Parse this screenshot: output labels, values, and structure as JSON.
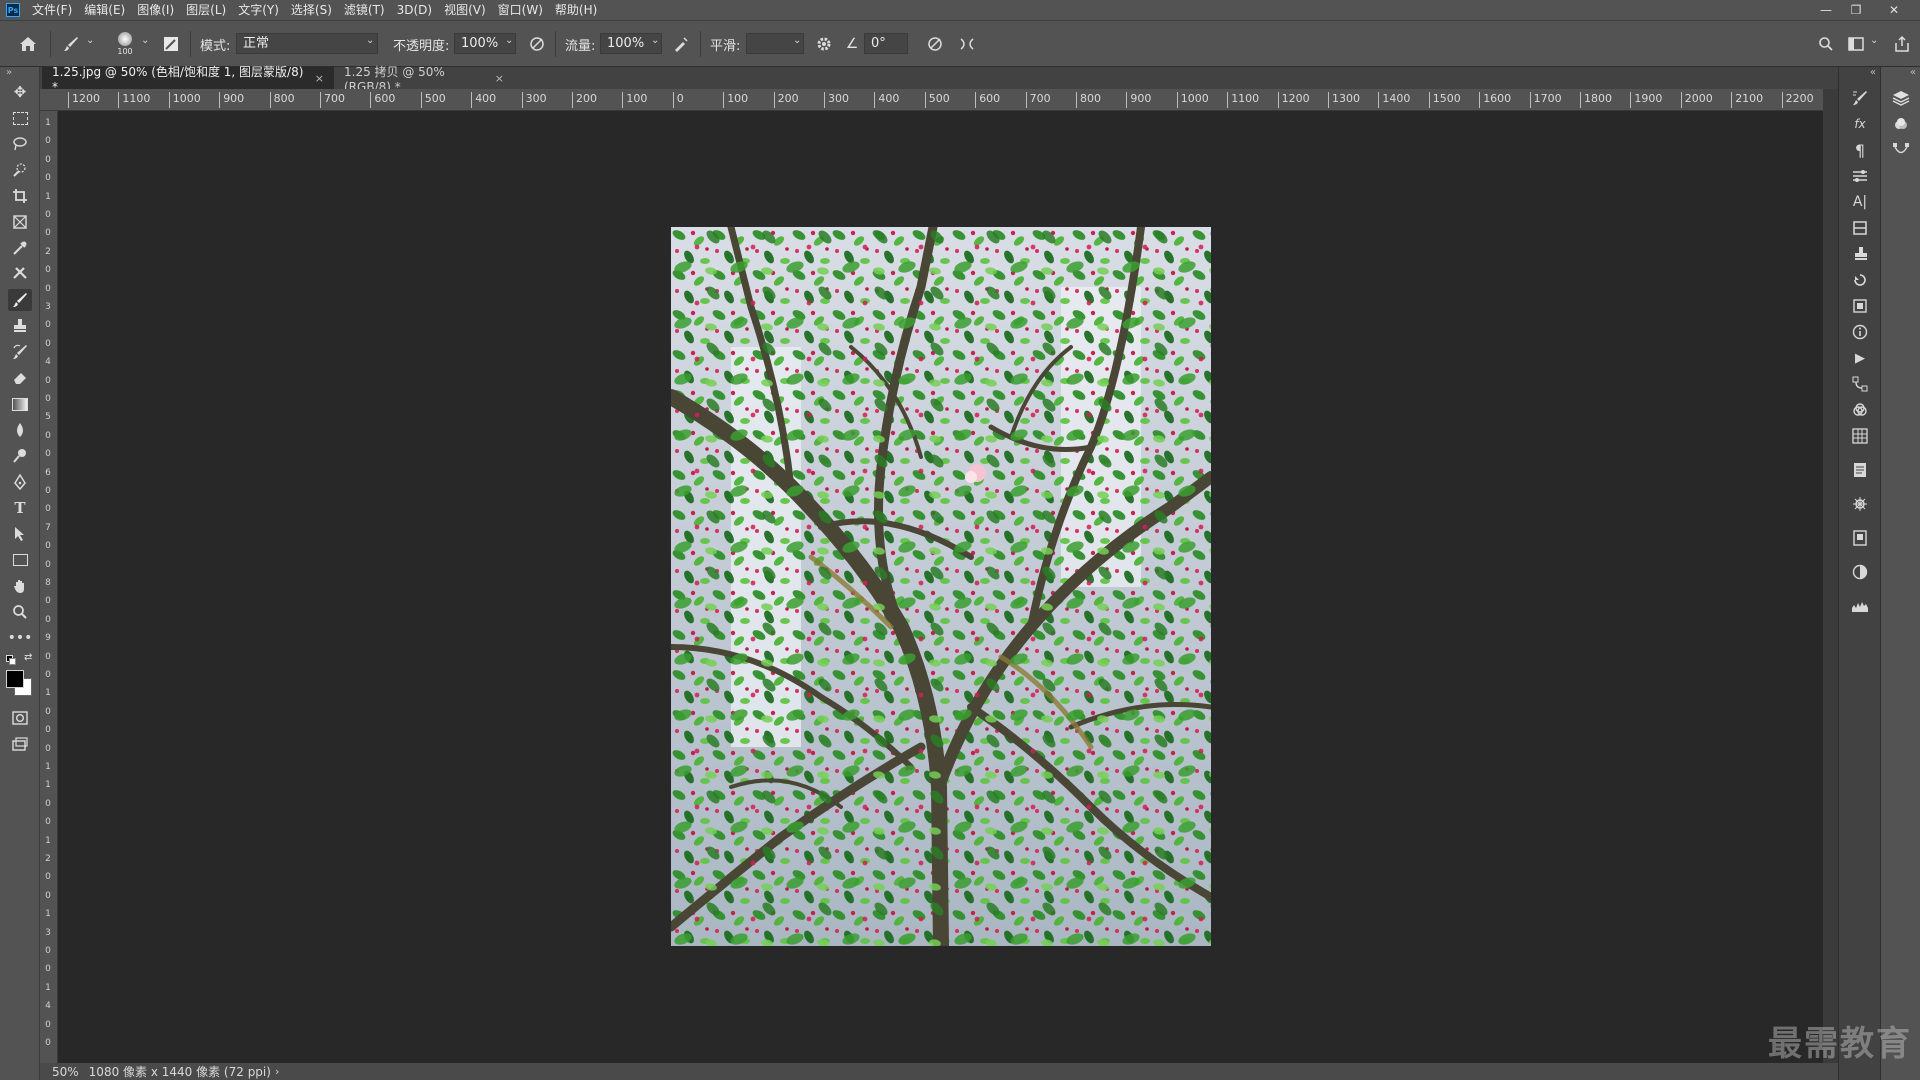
{
  "app": {
    "logo_text": "Ps"
  },
  "menu": [
    "文件(F)",
    "编辑(E)",
    "图像(I)",
    "图层(L)",
    "文字(Y)",
    "选择(S)",
    "滤镜(T)",
    "3D(D)",
    "视图(V)",
    "窗口(W)",
    "帮助(H)"
  ],
  "options": {
    "brush_size": "100",
    "mode_label": "模式:",
    "mode_value": "正常",
    "opacity_label": "不透明度:",
    "opacity_value": "100%",
    "flow_label": "流量:",
    "flow_value": "100%",
    "smoothing_label": "平滑:",
    "smoothing_value": "",
    "angle_value": "0°"
  },
  "tabs": [
    {
      "label": "1.25.jpg @ 50% (色相/饱和度 1, 图层蒙版/8) *",
      "active": true
    },
    {
      "label": "1.25 拷贝 @ 50%(RGB/8) *",
      "active": false
    }
  ],
  "ruler_h": [
    "1200",
    "1100",
    "1000",
    "900",
    "800",
    "700",
    "600",
    "500",
    "400",
    "300",
    "200",
    "100",
    "0",
    "100",
    "200",
    "300",
    "400",
    "500",
    "600",
    "700",
    "800",
    "900",
    "1000",
    "1100",
    "1200",
    "1300",
    "1400",
    "1500",
    "1600",
    "1700",
    "1800",
    "1900",
    "2000",
    "2100",
    "2200"
  ],
  "ruler_v": [
    "1",
    "0",
    "0",
    "0",
    "1",
    "0",
    "0",
    "2",
    "0",
    "0",
    "3",
    "0",
    "0",
    "4",
    "0",
    "0",
    "5",
    "0",
    "0",
    "6",
    "0",
    "0",
    "7",
    "0",
    "0",
    "8",
    "0",
    "0",
    "9",
    "0",
    "0",
    "1",
    "0",
    "0",
    "0",
    "1",
    "1",
    "0",
    "0",
    "1",
    "2",
    "0",
    "0",
    "1",
    "3",
    "0",
    "0",
    "1",
    "4",
    "0",
    "0"
  ],
  "status": {
    "zoom": "50%",
    "doc_info": "1080 像素 x 1440 像素 (72 ppi)"
  },
  "watermark": "最需教育",
  "colors": {
    "foreground": "#000000",
    "background": "#ffffff",
    "accent": "#31a8ff"
  }
}
